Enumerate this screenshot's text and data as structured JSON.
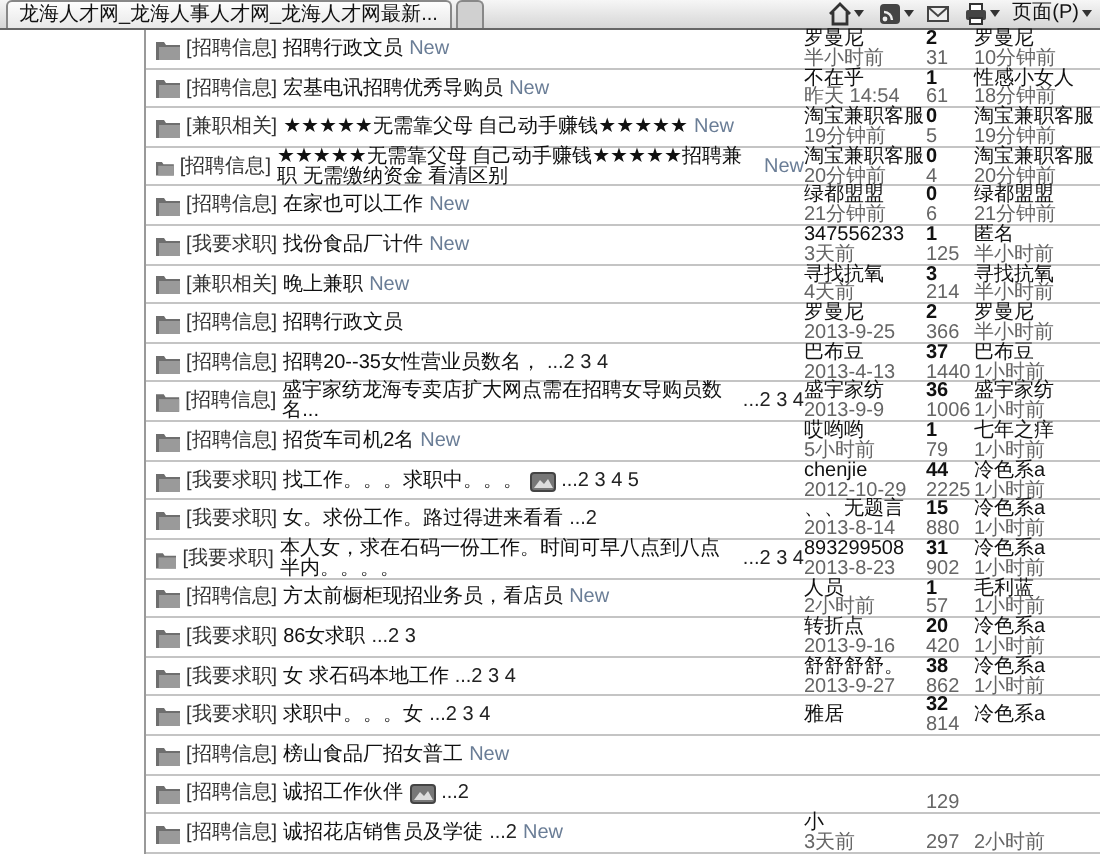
{
  "browser": {
    "tabs": [
      {
        "title": "龙海人才网_龙海人事人才网_龙海人才网最新...",
        "selected": true
      },
      {
        "selected": false
      }
    ],
    "toolbar": [
      {
        "kind": "home",
        "dropdown": true
      },
      {
        "kind": "feeds",
        "dropdown": true
      },
      {
        "kind": "mail",
        "dropdown": false
      },
      {
        "kind": "print",
        "dropdown": true
      },
      {
        "kind": "page",
        "label": "页面(P)",
        "dropdown": true
      }
    ]
  },
  "rows": [
    {
      "category": "[招聘信息]",
      "title": "招聘行政文员",
      "has_image": false,
      "new_label": "New",
      "author": "罗曼尼",
      "posted": "半小时前",
      "replies": "2",
      "views": "31",
      "last_poster": "罗曼尼",
      "last_time": "10分钟前"
    },
    {
      "category": "[招聘信息]",
      "title": "宏基电讯招聘优秀导购员",
      "has_image": false,
      "new_label": "New",
      "author": "不在乎",
      "posted": "昨天 14:54",
      "replies": "1",
      "views": "61",
      "last_poster": "性感小女人",
      "last_time": "18分钟前"
    },
    {
      "category": "[兼职相关]",
      "title": "★★★★★无需靠父母 自己动手赚钱★★★★★",
      "has_image": false,
      "new_label": "New",
      "author": "淘宝兼职客服",
      "posted": "19分钟前",
      "replies": "0",
      "views": "5",
      "last_poster": "淘宝兼职客服",
      "last_time": "19分钟前"
    },
    {
      "category": "[招聘信息]",
      "title": "★★★★★无需靠父母 自己动手赚钱★★★★★招聘兼职 无需缴纳资金 看清区别",
      "has_image": false,
      "new_label": "New",
      "author": "淘宝兼职客服",
      "posted": "20分钟前",
      "replies": "0",
      "views": "4",
      "last_poster": "淘宝兼职客服",
      "last_time": "20分钟前"
    },
    {
      "category": "[招聘信息]",
      "title": "在家也可以工作",
      "has_image": false,
      "new_label": "New",
      "author": "绿都盟盟",
      "posted": "21分钟前",
      "replies": "0",
      "views": "6",
      "last_poster": "绿都盟盟",
      "last_time": "21分钟前"
    },
    {
      "category": "[我要求职]",
      "title": "找份食品厂计件",
      "has_image": false,
      "new_label": "New",
      "author": "347556233",
      "posted": "3天前",
      "replies": "1",
      "views": "125",
      "last_poster": "匿名",
      "last_time": "半小时前"
    },
    {
      "category": "[兼职相关]",
      "title": "晚上兼职",
      "has_image": false,
      "new_label": "New",
      "author": "寻找抗氧",
      "posted": "4天前",
      "replies": "3",
      "views": "214",
      "last_poster": "寻找抗氧",
      "last_time": "半小时前"
    },
    {
      "category": "[招聘信息]",
      "title": "招聘行政文员",
      "has_image": false,
      "author": "罗曼尼",
      "posted": "2013-9-25",
      "replies": "2",
      "views": "366",
      "last_poster": "罗曼尼",
      "last_time": "半小时前"
    },
    {
      "category": "[招聘信息]",
      "title": "招聘20--35女性营业员数名，",
      "has_image": false,
      "pages": "...2 3 4",
      "author": "巴布豆",
      "posted": "2013-4-13",
      "replies": "37",
      "views": "1440",
      "last_poster": "巴布豆",
      "last_time": "1小时前"
    },
    {
      "category": "[招聘信息]",
      "title": "盛宇家纺龙海专卖店扩大网点需在招聘女导购员数名...",
      "has_image": false,
      "pages": "...2 3 4",
      "author": "盛宇家纺",
      "posted": "2013-9-9",
      "replies": "36",
      "views": "1006",
      "last_poster": "盛宇家纺",
      "last_time": "1小时前"
    },
    {
      "category": "[招聘信息]",
      "title": "招货车司机2名",
      "has_image": false,
      "new_label": "New",
      "author": "哎哟哟",
      "posted": "5小时前",
      "replies": "1",
      "views": "79",
      "last_poster": "七年之痒",
      "last_time": "1小时前"
    },
    {
      "category": "[我要求职]",
      "title": "找工作。。。求职中。。。",
      "has_image": true,
      "pages": "...2 3 4 5",
      "author": "chenjie",
      "posted": "2012-10-29",
      "replies": "44",
      "views": "2225",
      "last_poster": "冷色系a",
      "last_time": "1小时前"
    },
    {
      "category": "[我要求职]",
      "title": "女。求份工作。路过得进来看看",
      "has_image": false,
      "pages": "...2",
      "author": "、、无题言",
      "posted": "2013-8-14",
      "replies": "15",
      "views": "880",
      "last_poster": "冷色系a",
      "last_time": "1小时前"
    },
    {
      "category": "[我要求职]",
      "title": "本人女，求在石码一份工作。时间可早八点到八点半内。。。。",
      "has_image": false,
      "pages": "...2 3 4",
      "author": "893299508",
      "posted": "2013-8-23",
      "replies": "31",
      "views": "902",
      "last_poster": "冷色系a",
      "last_time": "1小时前"
    },
    {
      "category": "[招聘信息]",
      "title": "方太前橱柜现招业务员，看店员",
      "has_image": false,
      "new_label": "New",
      "author": "人员",
      "posted": "2小时前",
      "replies": "1",
      "views": "57",
      "last_poster": "毛利蓝",
      "last_time": "1小时前"
    },
    {
      "category": "[我要求职]",
      "title": "86女求职",
      "has_image": false,
      "pages": "...2 3",
      "author": "转折点",
      "posted": "2013-9-16",
      "replies": "20",
      "views": "420",
      "last_poster": "冷色系a",
      "last_time": "1小时前"
    },
    {
      "category": "[我要求职]",
      "title": "女 求石码本地工作",
      "has_image": false,
      "pages": "...2 3 4",
      "author": "舒舒舒舒。",
      "posted": "2013-9-27",
      "replies": "38",
      "views": "862",
      "last_poster": "冷色系a",
      "last_time": "1小时前"
    },
    {
      "category": "[我要求职]",
      "title": "求职中。。。女",
      "has_image": false,
      "pages": "...2 3 4",
      "author": "雅居",
      "replies": "32",
      "views": "814",
      "last_poster": "冷色系a"
    },
    {
      "category": "[招聘信息]",
      "title": "榜山食品厂招女普工",
      "has_image": false,
      "new_label": "New"
    },
    {
      "category": "[招聘信息]",
      "title": "诚招工作伙伴",
      "has_image": true,
      "pages": "...2",
      "views": "129"
    },
    {
      "category": "[招聘信息]",
      "title": "诚招花店销售员及学徒",
      "has_image": false,
      "pages": "...2",
      "new_label": "New",
      "author": "小",
      "posted": "3天前",
      "views": "297",
      "last_time": "2小时前"
    }
  ]
}
